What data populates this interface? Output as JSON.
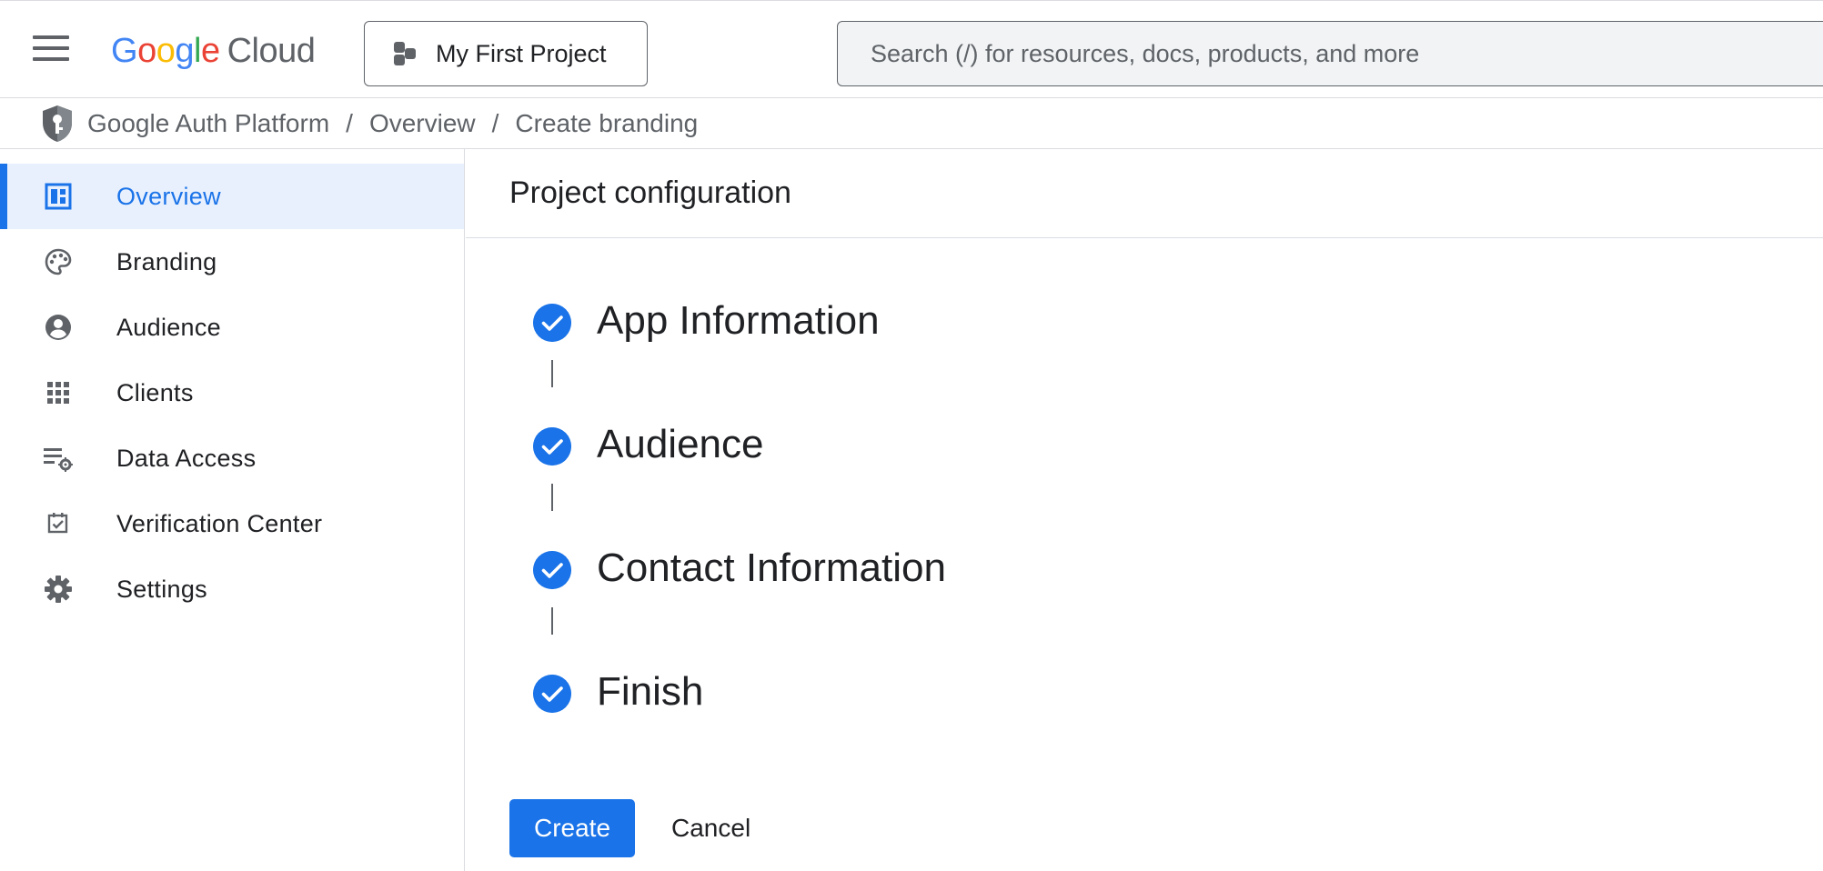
{
  "header": {
    "logo": {
      "letters": [
        "G",
        "o",
        "o",
        "g",
        "l",
        "e"
      ],
      "cloud": "Cloud"
    },
    "project_selector": "My First Project",
    "search_placeholder": "Search (/) for resources, docs, products, and more"
  },
  "breadcrumb": [
    "Google Auth Platform",
    "Overview",
    "Create branding"
  ],
  "breadcrumb_separator": "/",
  "sidebar": {
    "items": [
      {
        "label": "Overview",
        "icon": "dashboard-icon",
        "active": true
      },
      {
        "label": "Branding",
        "icon": "palette-icon",
        "active": false
      },
      {
        "label": "Audience",
        "icon": "account-circle-icon",
        "active": false
      },
      {
        "label": "Clients",
        "icon": "apps-grid-icon",
        "active": false
      },
      {
        "label": "Data Access",
        "icon": "list-settings-icon",
        "active": false
      },
      {
        "label": "Verification Center",
        "icon": "checkbox-icon",
        "active": false
      },
      {
        "label": "Settings",
        "icon": "gear-icon",
        "active": false
      }
    ]
  },
  "main": {
    "title": "Project configuration",
    "steps": [
      {
        "label": "App Information",
        "status": "complete"
      },
      {
        "label": "Audience",
        "status": "complete"
      },
      {
        "label": "Contact Information",
        "status": "complete"
      },
      {
        "label": "Finish",
        "status": "complete"
      }
    ],
    "create_label": "Create",
    "cancel_label": "Cancel"
  },
  "colors": {
    "accent": "#1a73e8",
    "active_bg": "#e8f0fe",
    "icon_gray": "#5f6368",
    "border": "#dadce0"
  }
}
